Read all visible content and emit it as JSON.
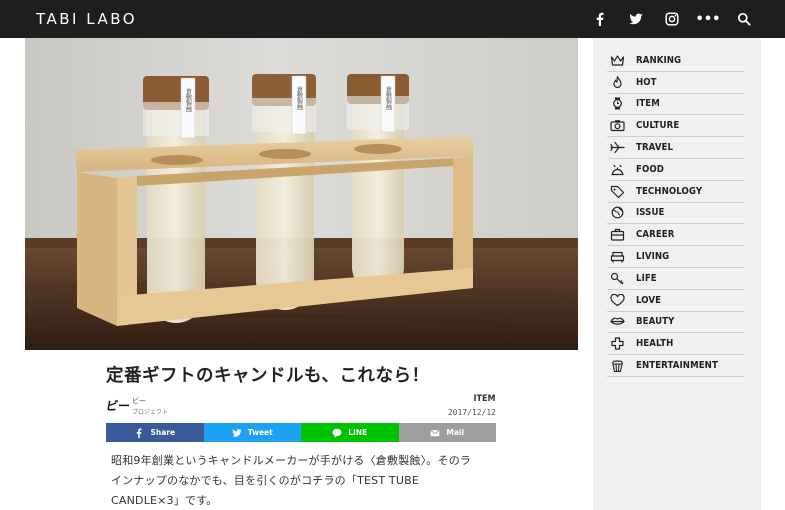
{
  "header": {
    "logo": "TABI LABO",
    "icons": [
      "facebook-icon",
      "twitter-icon",
      "instagram-icon",
      "more-icon",
      "search-icon"
    ],
    "more_label": "•••"
  },
  "hero": {
    "tube_labels": [
      "倉敷製蝕",
      "倉敷製蝕",
      "倉敷製蝕"
    ]
  },
  "sidebar": {
    "categories": [
      {
        "label": "RANKING",
        "icon": "crown-icon"
      },
      {
        "label": "HOT",
        "icon": "flame-icon"
      },
      {
        "label": "ITEM",
        "icon": "watch-icon"
      },
      {
        "label": "CULTURE",
        "icon": "camera-icon"
      },
      {
        "label": "TRAVEL",
        "icon": "airplane-icon"
      },
      {
        "label": "FOOD",
        "icon": "food-icon"
      },
      {
        "label": "TECHNOLOGY",
        "icon": "tag-icon"
      },
      {
        "label": "ISSUE",
        "icon": "globe-icon"
      },
      {
        "label": "CAREER",
        "icon": "briefcase-icon"
      },
      {
        "label": "LIVING",
        "icon": "sofa-icon"
      },
      {
        "label": "LIFE",
        "icon": "key-icon"
      },
      {
        "label": "LOVE",
        "icon": "heart-icon"
      },
      {
        "label": "BEAUTY",
        "icon": "lips-icon"
      },
      {
        "label": "HEALTH",
        "icon": "cross-icon"
      },
      {
        "label": "ENTERTAINMENT",
        "icon": "popcorn-icon"
      }
    ]
  },
  "article": {
    "title": "定番ギフトのキャンドルも、これなら！",
    "author_mark": "ビー",
    "author_name": "ビー",
    "author_sub": "プロジェクト",
    "category": "ITEM",
    "date": "2017/12/12",
    "share": {
      "facebook": "Share",
      "twitter": "Tweet",
      "line": "LINE",
      "mail": "Mail"
    },
    "lead_line1": "昭和9年創業というキャンドルメーカーが手がける〈倉敷製蝕〉。そのラ",
    "lead_line2": "インナップのなかでも、目を引くのがコチラの「TEST TUBE",
    "lead_line3": "CANDLE×3」です。"
  },
  "colors": {
    "header_bg": "#1e1e1e",
    "facebook": "#3b5a9a",
    "twitter": "#1da1f2",
    "line": "#00c300",
    "mail": "#9e9e9e",
    "sidebar_bg": "#f0f0f0"
  }
}
